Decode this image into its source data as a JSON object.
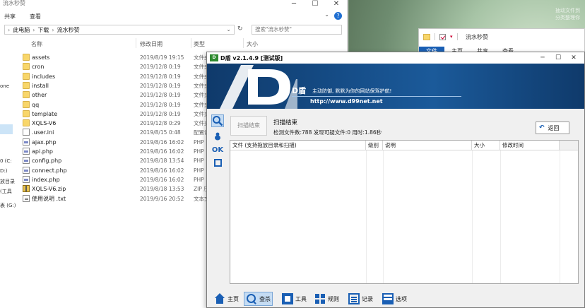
{
  "explorer": {
    "title": "流水秒赞",
    "ribbon": {
      "share": "共享",
      "view": "查看"
    },
    "address": {
      "pc": "此电脑",
      "downloads": "下载",
      "folder": "流水秒赞"
    },
    "search_placeholder": "搜索\"流水秒赞\"",
    "columns": {
      "name": "名称",
      "date": "修改日期",
      "type": "类型",
      "size": "大小"
    },
    "nav_partial": [
      "one",
      "0 (C:",
      "D:)",
      "放目录",
      "(工具",
      "表 (G:)"
    ],
    "files": [
      {
        "name": "assets",
        "date": "2019/8/19 19:15",
        "type": "文件夹",
        "icon": "folder-icon"
      },
      {
        "name": "cron",
        "date": "2019/12/8 0:19",
        "type": "文件夹",
        "icon": "folder-icon"
      },
      {
        "name": "includes",
        "date": "2019/12/8 0:19",
        "type": "文件夹",
        "icon": "folder-icon"
      },
      {
        "name": "install",
        "date": "2019/12/8 0:19",
        "type": "文件夹",
        "icon": "folder-icon"
      },
      {
        "name": "other",
        "date": "2019/12/8 0:19",
        "type": "文件夹",
        "icon": "folder-icon"
      },
      {
        "name": "qq",
        "date": "2019/12/8 0:19",
        "type": "文件夹",
        "icon": "folder-icon"
      },
      {
        "name": "template",
        "date": "2019/12/8 0:19",
        "type": "文件夹",
        "icon": "folder-icon"
      },
      {
        "name": "XQLS-V6",
        "date": "2019/12/8 0:29",
        "type": "文件夹",
        "icon": "folder-icon"
      },
      {
        "name": ".user.ini",
        "date": "2019/8/15 0:48",
        "type": "配置设",
        "icon": "config-file-icon"
      },
      {
        "name": "ajax.php",
        "date": "2019/8/16 16:02",
        "type": "PHP",
        "icon": "php-file-icon"
      },
      {
        "name": "api.php",
        "date": "2019/8/16 16:02",
        "type": "PHP",
        "icon": "php-file-icon"
      },
      {
        "name": "config.php",
        "date": "2019/8/18 13:54",
        "type": "PHP",
        "icon": "php-file-icon"
      },
      {
        "name": "connect.php",
        "date": "2019/8/16 16:02",
        "type": "PHP",
        "icon": "php-file-icon"
      },
      {
        "name": "index.php",
        "date": "2019/8/16 16:02",
        "type": "PHP",
        "icon": "php-file-icon"
      },
      {
        "name": "XQLS-V6.zip",
        "date": "2019/8/18 13:53",
        "type": "ZIP 压",
        "icon": "zip-file-icon"
      },
      {
        "name": "使用说明 .txt",
        "date": "2019/9/16 20:52",
        "type": "文本文",
        "icon": "text-file-icon"
      }
    ]
  },
  "desktop": {
    "note_line1": "抽动文件到",
    "note_line2": "分类整理你"
  },
  "explorer2": {
    "title": "流水秒赞",
    "tabs": [
      "文件",
      "主页",
      "共享",
      "查看"
    ]
  },
  "dshield": {
    "title": "D盾 v2.1.4.9 [测试版]",
    "logo_text": "D",
    "banner": {
      "name": "D盾",
      "slogan": "主动防御, 默默为你的网站保驾护航!",
      "url": "http://www.d99net.net"
    },
    "scan_button": "扫描结束",
    "status_title": "扫描结束",
    "status_info": "检测文件数:788 发现可疑文件:0 用时:1.86秒",
    "back_button": "返回",
    "table_headers": [
      "文件 (支持拖放目录和扫描)",
      "级别",
      "说明",
      "大小",
      "修改时间"
    ],
    "left_tools": {
      "ok": "OK"
    },
    "bottom_tabs": [
      {
        "label": "主页",
        "icon": "home-icon"
      },
      {
        "label": "查杀",
        "icon": "search-icon"
      },
      {
        "label": "工具",
        "icon": "tools-icon"
      },
      {
        "label": "规则",
        "icon": "rules-icon"
      },
      {
        "label": "记录",
        "icon": "log-icon"
      },
      {
        "label": "选项",
        "icon": "options-icon"
      }
    ]
  }
}
